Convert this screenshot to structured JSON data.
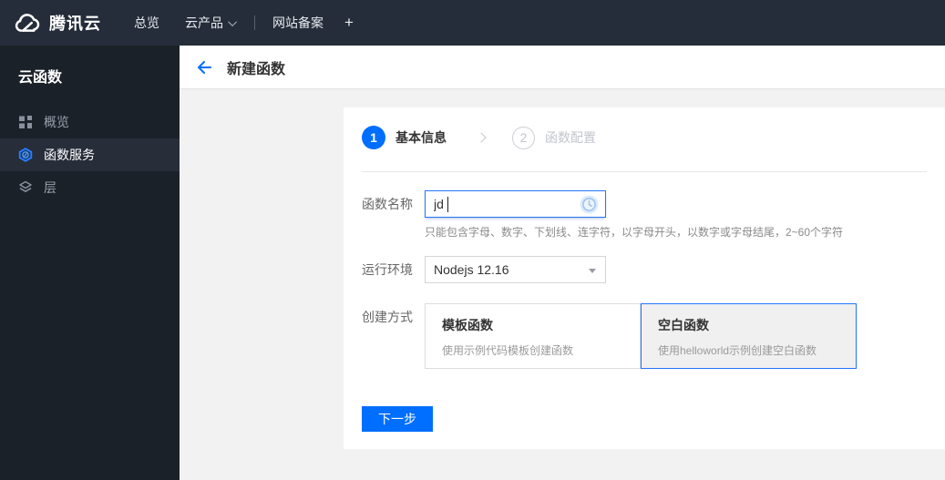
{
  "topbar": {
    "brand": "腾讯云",
    "items": [
      {
        "label": "总览"
      },
      {
        "label": "云产品"
      },
      {
        "label": "网站备案"
      },
      {
        "label": "+"
      }
    ]
  },
  "sidebar": {
    "title": "云函数",
    "items": [
      {
        "label": "概览",
        "icon": "grid-icon",
        "active": false
      },
      {
        "label": "函数服务",
        "icon": "scf-hexagon-icon",
        "active": true
      },
      {
        "label": "层",
        "icon": "layers-icon",
        "active": false
      }
    ]
  },
  "header": {
    "title": "新建函数"
  },
  "wizard": {
    "steps": [
      {
        "num": "1",
        "label": "基本信息",
        "state": "active"
      },
      {
        "num": "2",
        "label": "函数配置",
        "state": "pending"
      }
    ]
  },
  "form": {
    "name": {
      "label": "函数名称",
      "value": "jd",
      "hint": "只能包含字母、数字、下划线、连字符，以字母开头，以数字或字母结尾，2~60个字符",
      "status_icon": "clock-pending-icon"
    },
    "runtime": {
      "label": "运行环境",
      "value": "Nodejs 12.16"
    },
    "method": {
      "label": "创建方式",
      "options": [
        {
          "title": "模板函数",
          "desc": "使用示例代码模板创建函数",
          "selected": false
        },
        {
          "title": "空白函数",
          "desc": "使用helloworld示例创建空白函数",
          "selected": true
        }
      ]
    }
  },
  "actions": {
    "next": "下一步"
  },
  "colors": {
    "accent": "#006eff",
    "topbar_bg": "#252d3a",
    "sidebar_bg": "#1b2129",
    "sidebar_active_bg": "#272e3a",
    "selected_card_border": "#2476ff",
    "content_bg": "#f2f2f2"
  }
}
